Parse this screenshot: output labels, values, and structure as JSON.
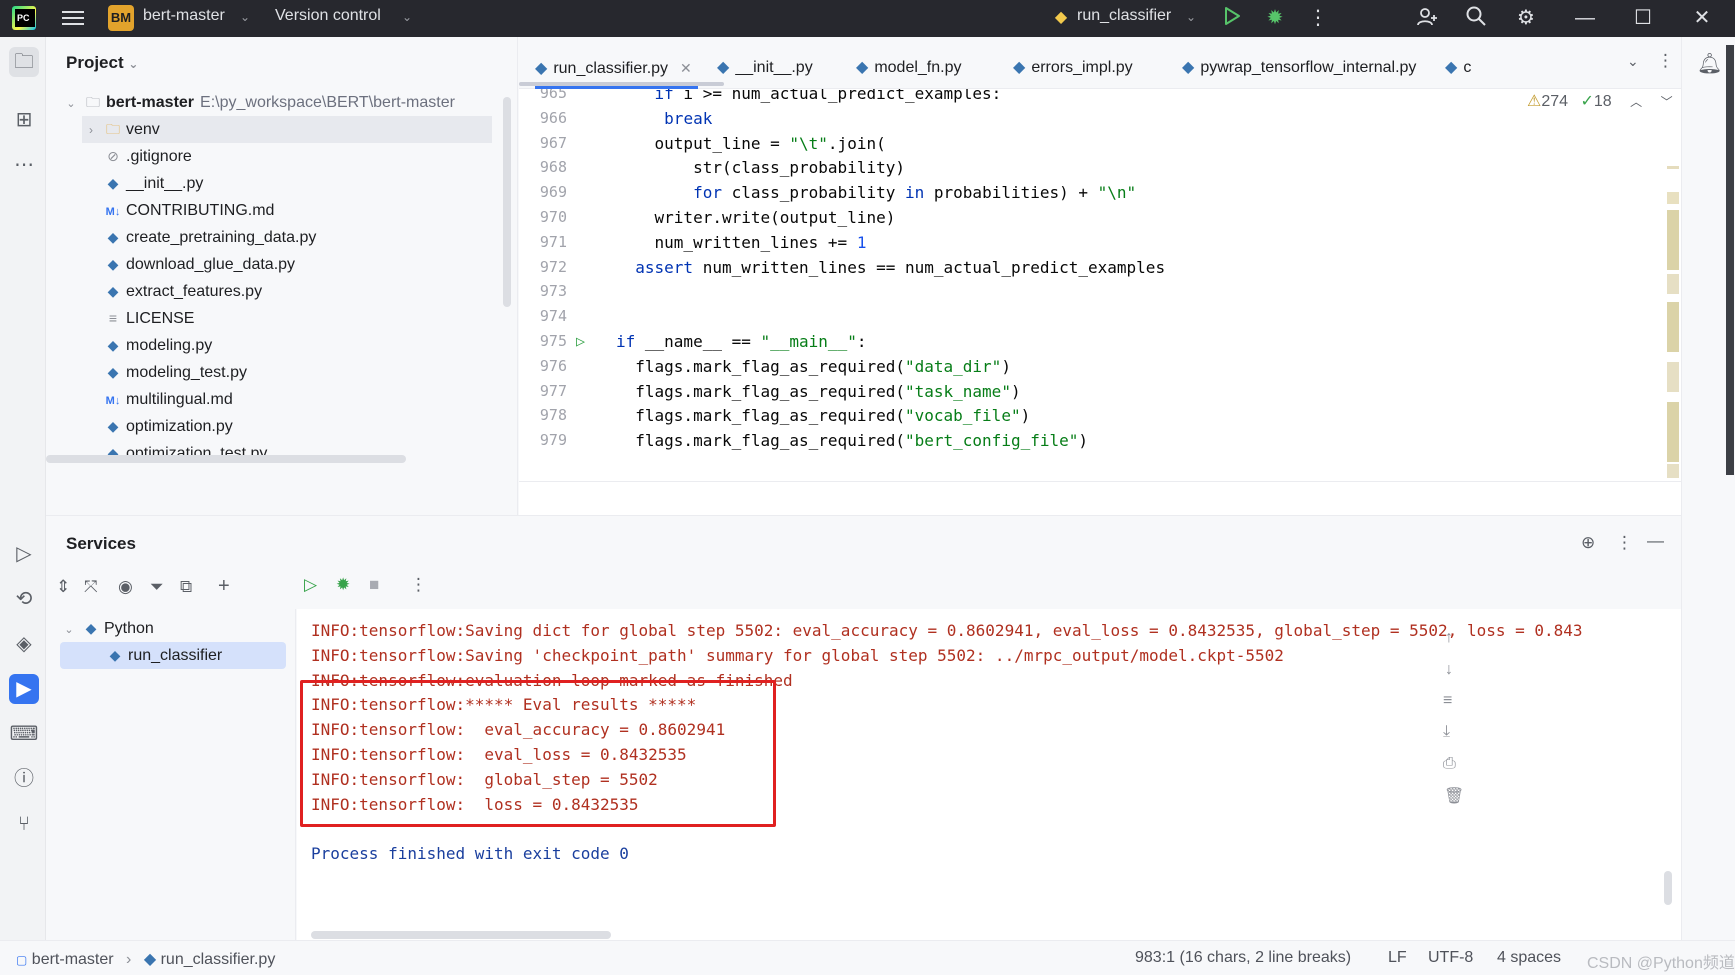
{
  "titlebar": {
    "project_badge": "BM",
    "project_name": "bert-master",
    "vcs_label": "Version control",
    "run_config": "run_classifier"
  },
  "project_panel": {
    "title": "Project",
    "root": {
      "name": "bert-master",
      "path": "E:\\py_workspace\\BERT\\bert-master"
    },
    "items": [
      {
        "name": "venv",
        "type": "folder"
      },
      {
        "name": ".gitignore",
        "type": "ignore"
      },
      {
        "name": "__init__.py",
        "type": "python"
      },
      {
        "name": "CONTRIBUTING.md",
        "type": "markdown"
      },
      {
        "name": "create_pretraining_data.py",
        "type": "python"
      },
      {
        "name": "download_glue_data.py",
        "type": "python"
      },
      {
        "name": "extract_features.py",
        "type": "python"
      },
      {
        "name": "LICENSE",
        "type": "text"
      },
      {
        "name": "modeling.py",
        "type": "python"
      },
      {
        "name": "modeling_test.py",
        "type": "python"
      },
      {
        "name": "multilingual.md",
        "type": "markdown"
      },
      {
        "name": "optimization.py",
        "type": "python"
      },
      {
        "name": "optimization_test.py",
        "type": "python"
      }
    ]
  },
  "editor": {
    "tabs": [
      {
        "label": "run_classifier.py",
        "active": true
      },
      {
        "label": "__init__.py"
      },
      {
        "label": "model_fn.py"
      },
      {
        "label": "errors_impl.py"
      },
      {
        "label": "pywrap_tensorflow_internal.py"
      },
      {
        "label": "c"
      }
    ],
    "inspections": {
      "warnings": "274",
      "ok": "18"
    },
    "lines": [
      {
        "n": "965",
        "html": "    <span class=\"kw\">if</span> i >= num_actual_predict_examples:"
      },
      {
        "n": "966",
        "html": "     <span class=\"kw\">break</span>"
      },
      {
        "n": "967",
        "html": "    output_line = <span class=\"str\">\"\\t\"</span>.join("
      },
      {
        "n": "968",
        "html": "        str(class_probability)"
      },
      {
        "n": "969",
        "html": "        <span class=\"kw\">for</span> class_probability <span class=\"kw\">in</span> probabilities) + <span class=\"str\">\"\\n\"</span>"
      },
      {
        "n": "970",
        "html": "    writer.write(output_line)"
      },
      {
        "n": "971",
        "html": "    num_written_lines += <span class=\"num\">1</span>"
      },
      {
        "n": "972",
        "html": "  <span class=\"kw\">assert</span> num_written_lines == num_actual_predict_examples"
      },
      {
        "n": "973",
        "html": ""
      },
      {
        "n": "974",
        "html": ""
      },
      {
        "n": "975",
        "html": "<span class=\"kw\">if</span> __name__ == <span class=\"str\">\"__main__\"</span>:"
      },
      {
        "n": "976",
        "html": "  flags.mark_flag_as_required(<span class=\"str\">\"data_dir\"</span>)"
      },
      {
        "n": "977",
        "html": "  flags.mark_flag_as_required(<span class=\"str\">\"task_name\"</span>)"
      },
      {
        "n": "978",
        "html": "  flags.mark_flag_as_required(<span class=\"str\">\"vocab_file\"</span>)"
      },
      {
        "n": "979",
        "html": "  flags.mark_flag_as_required(<span class=\"str\">\"bert_config_file\"</span>)"
      }
    ]
  },
  "services": {
    "title": "Services",
    "tree": {
      "group": "Python",
      "item": "run_classifier"
    },
    "console": [
      "INFO:tensorflow:Saving dict for global step 5502: eval_accuracy = 0.8602941, eval_loss = 0.8432535, global_step = 5502, loss = 0.843",
      "INFO:tensorflow:Saving 'checkpoint_path' summary for global step 5502: ../mrpc_output/model.ckpt-5502",
      "INFO:tensorflow:evaluation loop marked as finished",
      "INFO:tensorflow:***** Eval results *****",
      "INFO:tensorflow:  eval_accuracy = 0.8602941",
      "INFO:tensorflow:  eval_loss = 0.8432535",
      "INFO:tensorflow:  global_step = 5502",
      "INFO:tensorflow:  loss = 0.8432535",
      "",
      "Process finished with exit code 0"
    ]
  },
  "statusbar": {
    "crumb_project": "bert-master",
    "crumb_file": "run_classifier.py",
    "position": "983:1 (16 chars, 2 line breaks)",
    "line_sep": "LF",
    "encoding": "UTF-8",
    "indent": "4 spaces",
    "watermark": "CSDN @Python频道技术汇"
  },
  "colors": {
    "accent": "#3574f0",
    "highlight_box": "#e02020",
    "console_text": "#b03020"
  }
}
